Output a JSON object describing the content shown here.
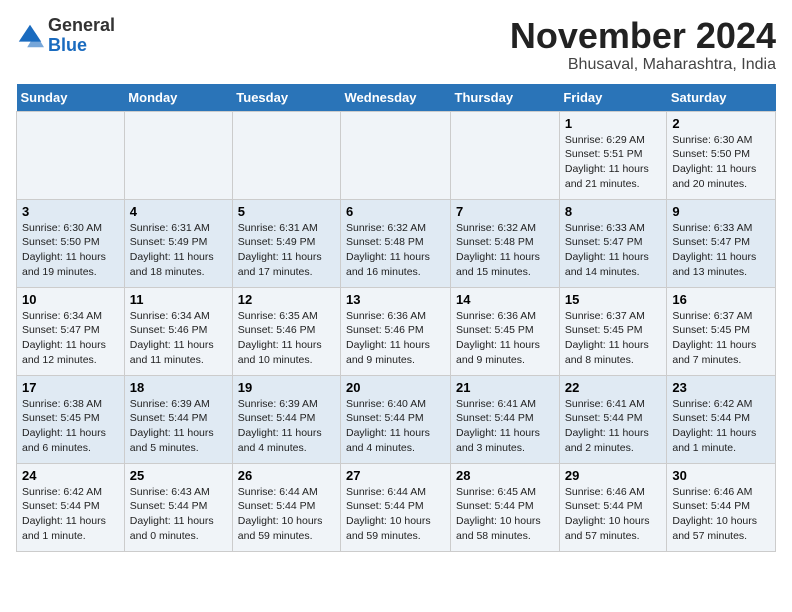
{
  "logo": {
    "general": "General",
    "blue": "Blue"
  },
  "header": {
    "month": "November 2024",
    "location": "Bhusaval, Maharashtra, India"
  },
  "weekdays": [
    "Sunday",
    "Monday",
    "Tuesday",
    "Wednesday",
    "Thursday",
    "Friday",
    "Saturday"
  ],
  "weeks": [
    [
      {
        "day": "",
        "info": ""
      },
      {
        "day": "",
        "info": ""
      },
      {
        "day": "",
        "info": ""
      },
      {
        "day": "",
        "info": ""
      },
      {
        "day": "",
        "info": ""
      },
      {
        "day": "1",
        "info": "Sunrise: 6:29 AM\nSunset: 5:51 PM\nDaylight: 11 hours and 21 minutes."
      },
      {
        "day": "2",
        "info": "Sunrise: 6:30 AM\nSunset: 5:50 PM\nDaylight: 11 hours and 20 minutes."
      }
    ],
    [
      {
        "day": "3",
        "info": "Sunrise: 6:30 AM\nSunset: 5:50 PM\nDaylight: 11 hours and 19 minutes."
      },
      {
        "day": "4",
        "info": "Sunrise: 6:31 AM\nSunset: 5:49 PM\nDaylight: 11 hours and 18 minutes."
      },
      {
        "day": "5",
        "info": "Sunrise: 6:31 AM\nSunset: 5:49 PM\nDaylight: 11 hours and 17 minutes."
      },
      {
        "day": "6",
        "info": "Sunrise: 6:32 AM\nSunset: 5:48 PM\nDaylight: 11 hours and 16 minutes."
      },
      {
        "day": "7",
        "info": "Sunrise: 6:32 AM\nSunset: 5:48 PM\nDaylight: 11 hours and 15 minutes."
      },
      {
        "day": "8",
        "info": "Sunrise: 6:33 AM\nSunset: 5:47 PM\nDaylight: 11 hours and 14 minutes."
      },
      {
        "day": "9",
        "info": "Sunrise: 6:33 AM\nSunset: 5:47 PM\nDaylight: 11 hours and 13 minutes."
      }
    ],
    [
      {
        "day": "10",
        "info": "Sunrise: 6:34 AM\nSunset: 5:47 PM\nDaylight: 11 hours and 12 minutes."
      },
      {
        "day": "11",
        "info": "Sunrise: 6:34 AM\nSunset: 5:46 PM\nDaylight: 11 hours and 11 minutes."
      },
      {
        "day": "12",
        "info": "Sunrise: 6:35 AM\nSunset: 5:46 PM\nDaylight: 11 hours and 10 minutes."
      },
      {
        "day": "13",
        "info": "Sunrise: 6:36 AM\nSunset: 5:46 PM\nDaylight: 11 hours and 9 minutes."
      },
      {
        "day": "14",
        "info": "Sunrise: 6:36 AM\nSunset: 5:45 PM\nDaylight: 11 hours and 9 minutes."
      },
      {
        "day": "15",
        "info": "Sunrise: 6:37 AM\nSunset: 5:45 PM\nDaylight: 11 hours and 8 minutes."
      },
      {
        "day": "16",
        "info": "Sunrise: 6:37 AM\nSunset: 5:45 PM\nDaylight: 11 hours and 7 minutes."
      }
    ],
    [
      {
        "day": "17",
        "info": "Sunrise: 6:38 AM\nSunset: 5:45 PM\nDaylight: 11 hours and 6 minutes."
      },
      {
        "day": "18",
        "info": "Sunrise: 6:39 AM\nSunset: 5:44 PM\nDaylight: 11 hours and 5 minutes."
      },
      {
        "day": "19",
        "info": "Sunrise: 6:39 AM\nSunset: 5:44 PM\nDaylight: 11 hours and 4 minutes."
      },
      {
        "day": "20",
        "info": "Sunrise: 6:40 AM\nSunset: 5:44 PM\nDaylight: 11 hours and 4 minutes."
      },
      {
        "day": "21",
        "info": "Sunrise: 6:41 AM\nSunset: 5:44 PM\nDaylight: 11 hours and 3 minutes."
      },
      {
        "day": "22",
        "info": "Sunrise: 6:41 AM\nSunset: 5:44 PM\nDaylight: 11 hours and 2 minutes."
      },
      {
        "day": "23",
        "info": "Sunrise: 6:42 AM\nSunset: 5:44 PM\nDaylight: 11 hours and 1 minute."
      }
    ],
    [
      {
        "day": "24",
        "info": "Sunrise: 6:42 AM\nSunset: 5:44 PM\nDaylight: 11 hours and 1 minute."
      },
      {
        "day": "25",
        "info": "Sunrise: 6:43 AM\nSunset: 5:44 PM\nDaylight: 11 hours and 0 minutes."
      },
      {
        "day": "26",
        "info": "Sunrise: 6:44 AM\nSunset: 5:44 PM\nDaylight: 10 hours and 59 minutes."
      },
      {
        "day": "27",
        "info": "Sunrise: 6:44 AM\nSunset: 5:44 PM\nDaylight: 10 hours and 59 minutes."
      },
      {
        "day": "28",
        "info": "Sunrise: 6:45 AM\nSunset: 5:44 PM\nDaylight: 10 hours and 58 minutes."
      },
      {
        "day": "29",
        "info": "Sunrise: 6:46 AM\nSunset: 5:44 PM\nDaylight: 10 hours and 57 minutes."
      },
      {
        "day": "30",
        "info": "Sunrise: 6:46 AM\nSunset: 5:44 PM\nDaylight: 10 hours and 57 minutes."
      }
    ]
  ]
}
